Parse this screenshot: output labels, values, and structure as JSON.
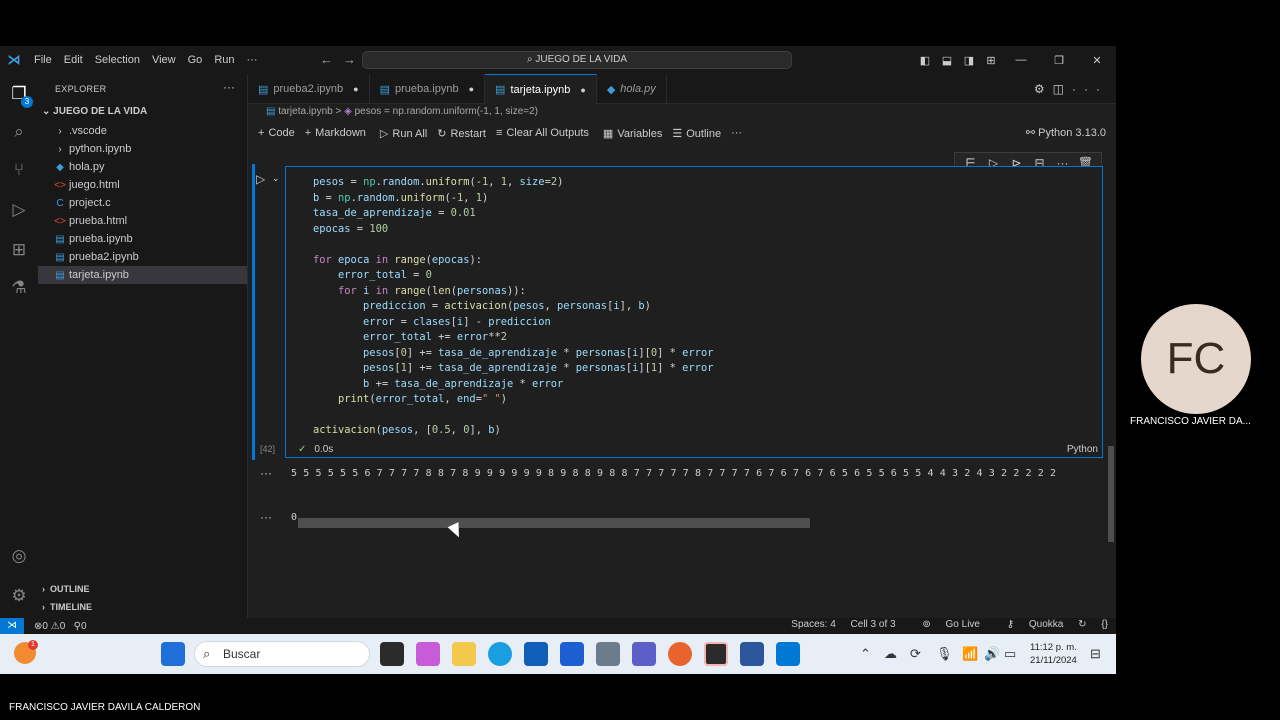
{
  "window": {
    "menu": [
      "File",
      "Edit",
      "Selection",
      "View",
      "Go",
      "Run",
      "···"
    ],
    "command_center": "JUEGO DE LA VIDA"
  },
  "explorer": {
    "title": "EXPLORER",
    "root": "JUEGO DE LA VIDA",
    "items": [
      {
        "name": ".vscode",
        "icon": "chevron-right-icon",
        "glyph": "›"
      },
      {
        "name": "python.ipynb",
        "icon": "chevron-right-icon",
        "glyph": "›"
      },
      {
        "name": "hola.py",
        "icon": "python-file-icon",
        "glyph": "◆",
        "color": "#3b9ddd"
      },
      {
        "name": "juego.html",
        "icon": "html-file-icon",
        "glyph": "<>",
        "color": "#e44d26"
      },
      {
        "name": "project.c",
        "icon": "c-file-icon",
        "glyph": "C",
        "color": "#3b9ddd"
      },
      {
        "name": "prueba.html",
        "icon": "html-file-icon",
        "glyph": "<>",
        "color": "#e44d26"
      },
      {
        "name": "prueba.ipynb",
        "icon": "notebook-file-icon",
        "glyph": "▤",
        "color": "#3b9ddd"
      },
      {
        "name": "prueba2.ipynb",
        "icon": "notebook-file-icon",
        "glyph": "▤",
        "color": "#3b9ddd"
      },
      {
        "name": "tarjeta.ipynb",
        "icon": "notebook-file-icon",
        "glyph": "▤",
        "color": "#3b9ddd",
        "selected": true
      }
    ],
    "outline": "OUTLINE",
    "timeline": "TIMELINE"
  },
  "tabs": [
    {
      "label": "prueba2.ipynb",
      "modified": true,
      "active": false,
      "italic": false
    },
    {
      "label": "prueba.ipynb",
      "modified": true,
      "active": false,
      "italic": false
    },
    {
      "label": "tarjeta.ipynb",
      "modified": true,
      "active": true,
      "italic": false
    },
    {
      "label": "hola.py",
      "modified": false,
      "active": false,
      "italic": true
    }
  ],
  "breadcrumb": {
    "file": "tarjeta.ipynb",
    "sep": ">",
    "symbol": "pesos = np.random.uniform(-1, 1, size=2)"
  },
  "toolbar": {
    "code": "Code",
    "markdown": "Markdown",
    "run_all": "Run All",
    "restart": "Restart",
    "clear": "Clear All Outputs",
    "variables": "Variables",
    "outline": "Outline",
    "more": "···",
    "kernel": "Python 3.13.0"
  },
  "cell": {
    "exec_count": "[42]",
    "duration": "0.0s",
    "language": "Python",
    "code_lines": [
      "pesos = np.random.uniform(-1, 1, size=2)",
      "b = np.random.uniform(-1, 1)",
      "tasa_de_aprendizaje = 0.01",
      "epocas = 100",
      "",
      "for epoca in range(epocas):",
      "    error_total = 0",
      "    for i in range(len(personas)):",
      "        prediccion = activacion(pesos, personas[i], b)",
      "        error = clases[i] - prediccion",
      "        error_total += error**2",
      "        pesos[0] += tasa_de_aprendizaje * personas[i][0] * error",
      "        pesos[1] += tasa_de_aprendizaje * personas[i][1] * error",
      "        b += tasa_de_aprendizaje * error",
      "    print(error_total, end=\" \")",
      "",
      "activacion(pesos, [0.5, 0], b)"
    ]
  },
  "outputs": {
    "stream": "5 5 5 5 5 5 6 7 7 7 7 8 8 7 8 9 9 9 9 9 9 8 9 8 8 9 8 8 7 7 7 7 7 8 7 7 7 7 6 7 6 7 6 7 6 5 6 5 5 6 5 5 4 4 3 2 4 3 2 2 2 2 2",
    "result": "0"
  },
  "statusbar": {
    "errors": "0",
    "warnings": "0",
    "ports": "0",
    "spaces": "Spaces: 4",
    "cell": "Cell 3 of 3",
    "golive": "Go Live",
    "quokka": "Quokka"
  },
  "taskbar": {
    "search_placeholder": "Buscar",
    "time": "11:12 p. m.",
    "date": "21/11/2024",
    "weather_badge": "1"
  },
  "participant": {
    "initials": "FC",
    "short_name": "FRANCISCO JAVIER DA...",
    "full_name": "FRANCISCO JAVIER DAVILA CALDERON"
  },
  "colors": {
    "accent": "#0078d4",
    "editor_bg": "#1f1f1f",
    "sidebar_bg": "#181818"
  }
}
